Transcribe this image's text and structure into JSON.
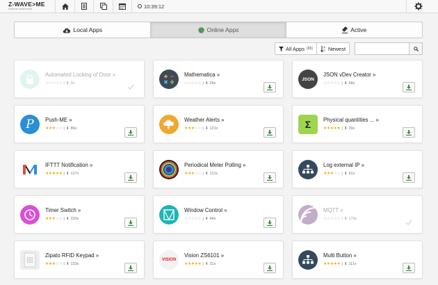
{
  "app": {
    "brand": "Z-WAVE>ME",
    "tagline": "Smart for smart home",
    "time": "10:39:12"
  },
  "tabs": [
    {
      "label": "Local Apps",
      "icon": "cloud-download-icon"
    },
    {
      "label": "Online Apps",
      "icon": "globe-icon",
      "active": true
    },
    {
      "label": "Active",
      "icon": "eraser-icon"
    }
  ],
  "toolbar": {
    "all_apps": "All Apps",
    "all_apps_count": "(65)",
    "sort": "Newest",
    "search_placeholder": ""
  },
  "apps": [
    {
      "title": "Automated Locking of Door »",
      "stars": 0,
      "downloads": "0x",
      "installed": true
    },
    {
      "title": "Mathematica »",
      "stars": 0,
      "downloads": "29x",
      "installed": false
    },
    {
      "title": "JSON vDev Creator »",
      "stars": 0,
      "downloads": "68x",
      "installed": false,
      "icon_label": "JSON"
    },
    {
      "title": "Push-ME »",
      "stars": 3,
      "downloads": "86x",
      "installed": false,
      "icon_label": "P"
    },
    {
      "title": "Weather Alerts »",
      "stars": 3,
      "downloads": "121x",
      "installed": false
    },
    {
      "title": "Physical quantities ... »",
      "stars": 5,
      "downloads": "29x",
      "installed": false,
      "icon_label": "Σ"
    },
    {
      "title": "IFTTT Notification »",
      "stars": 5,
      "downloads": "127x",
      "installed": false,
      "icon_label": "M"
    },
    {
      "title": "Periodical Meter Polling »",
      "stars": 3,
      "downloads": "121x",
      "installed": false
    },
    {
      "title": "Log external IP »",
      "stars": 3,
      "downloads": "91x",
      "installed": false
    },
    {
      "title": "Timer Switch »",
      "stars": 3,
      "downloads": "220x",
      "installed": false
    },
    {
      "title": "Window Control »",
      "stars": 0,
      "downloads": "44x",
      "installed": false
    },
    {
      "title": "MQTT »",
      "stars": 0,
      "downloads": "178x",
      "installed": true
    },
    {
      "title": "Zipato RFID Keypad »",
      "stars": 3,
      "downloads": "133x",
      "installed": false
    },
    {
      "title": "Vision ZS6101 »",
      "stars": 5,
      "downloads": "31x",
      "installed": false,
      "icon_label": "VISION"
    },
    {
      "title": "Multi Button »",
      "stars": 5,
      "downloads": "111x",
      "installed": false
    }
  ],
  "colors": {
    "accent_green": "#3d8b3d",
    "star": "#f0ad1a"
  }
}
